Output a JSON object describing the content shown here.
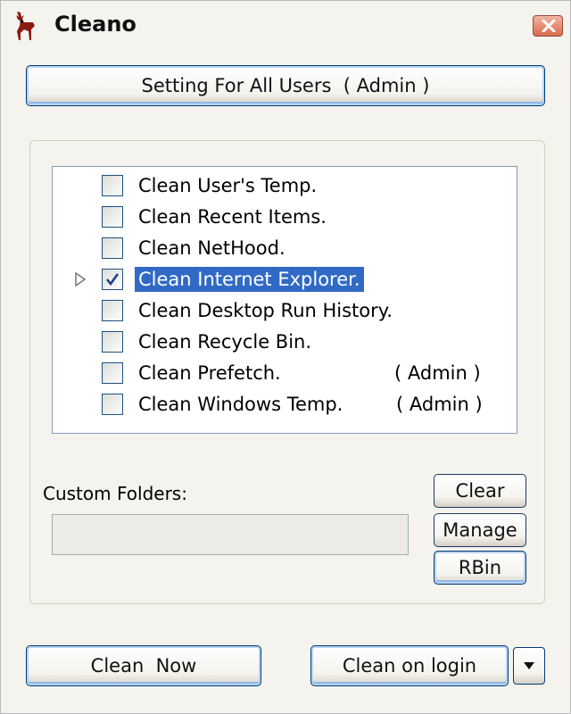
{
  "window": {
    "title": "Cleano"
  },
  "top_button": {
    "label": "Setting For All Users  ( Admin )"
  },
  "items": [
    {
      "label": "Clean User's Temp.",
      "checked": false,
      "selected": false,
      "admin": ""
    },
    {
      "label": "Clean Recent Items.",
      "checked": false,
      "selected": false,
      "admin": ""
    },
    {
      "label": "Clean NetHood.",
      "checked": false,
      "selected": false,
      "admin": ""
    },
    {
      "label": "Clean Internet Explorer.",
      "checked": true,
      "selected": true,
      "admin": ""
    },
    {
      "label": "Clean Desktop Run History.",
      "checked": false,
      "selected": false,
      "admin": ""
    },
    {
      "label": "Clean Recycle Bin.",
      "checked": false,
      "selected": false,
      "admin": ""
    },
    {
      "label": "Clean Prefetch.",
      "checked": false,
      "selected": false,
      "admin": "( Admin )"
    },
    {
      "label": "Clean Windows Temp.",
      "checked": false,
      "selected": false,
      "admin": "( Admin )"
    }
  ],
  "custom_folders": {
    "label": "Custom Folders:",
    "value": "",
    "buttons": {
      "clear": "Clear",
      "manage": "Manage",
      "rbin": "RBin"
    }
  },
  "bottom": {
    "clean_now": "Clean  Now",
    "clean_on_login": "Clean on login"
  },
  "colors": {
    "selection": "#316ac5",
    "button_border": "#003c74",
    "window_bg": "#f4f3ee"
  }
}
